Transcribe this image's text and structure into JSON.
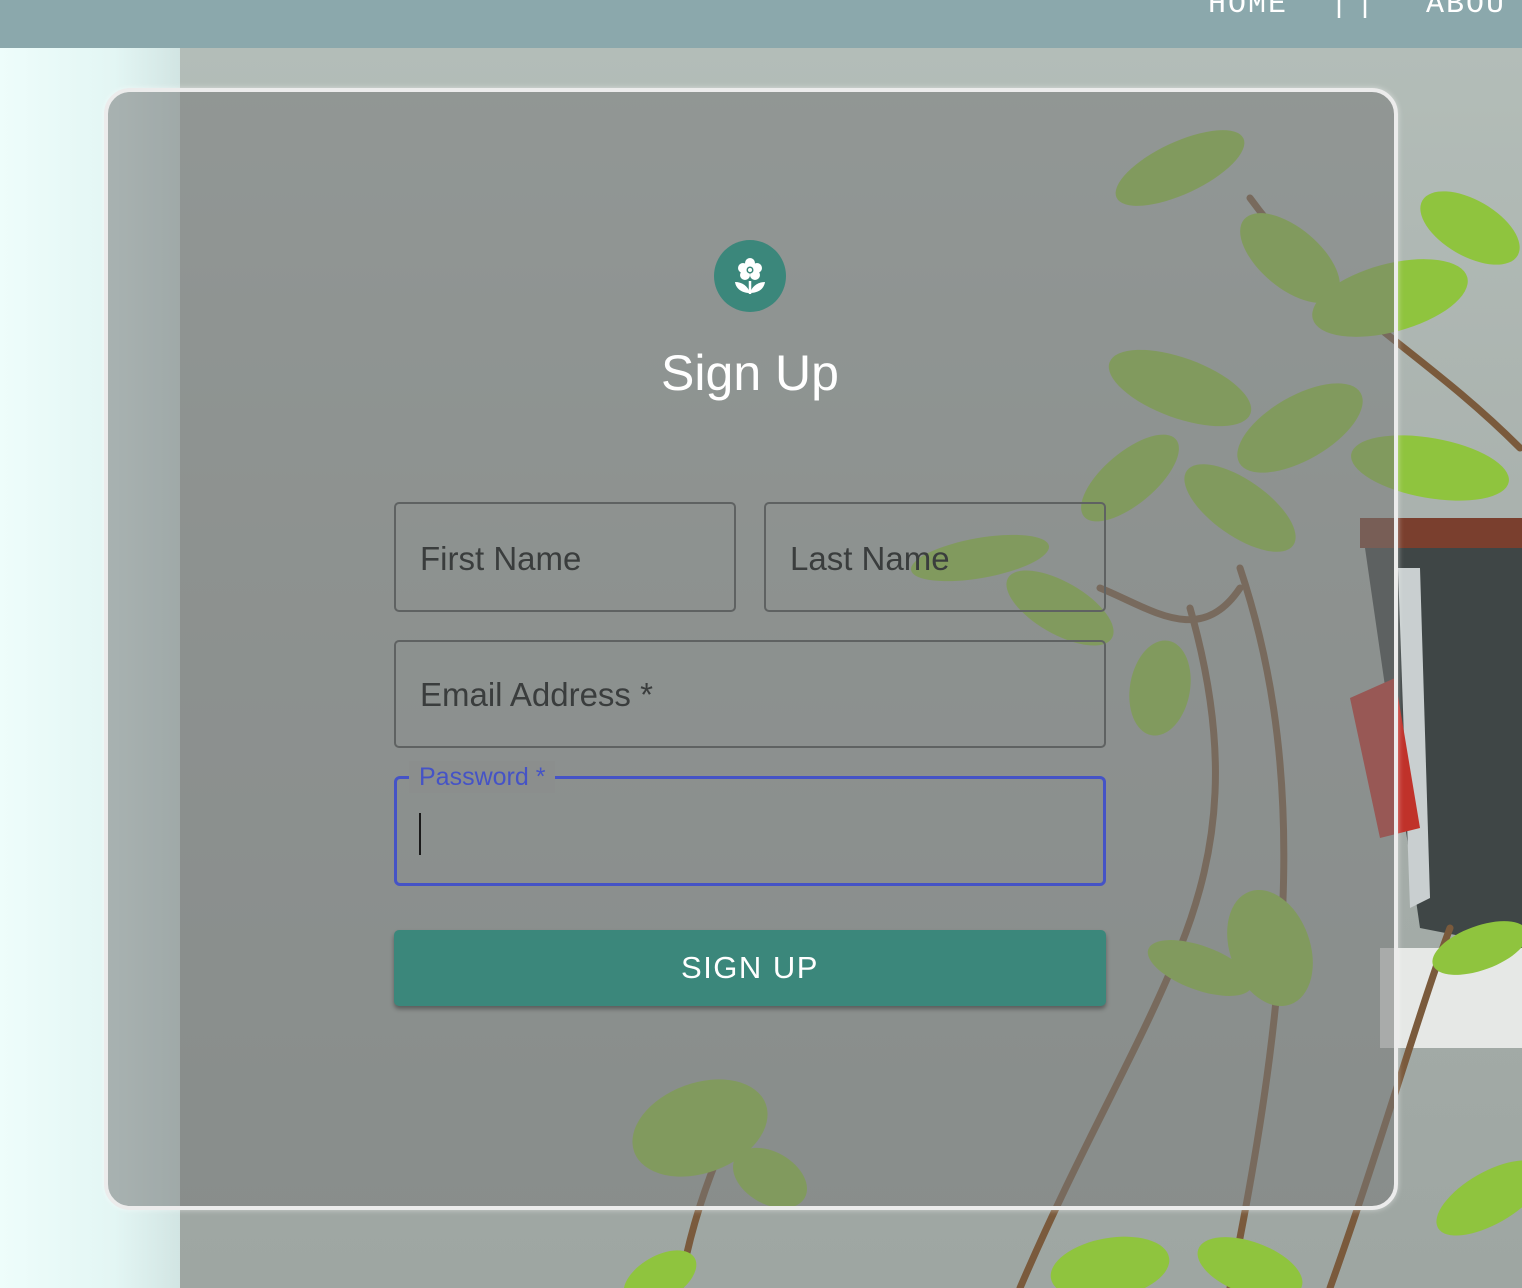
{
  "navbar": {
    "items": [
      {
        "label": "HOME"
      },
      {
        "label": "||"
      },
      {
        "label": "ABOU"
      }
    ]
  },
  "form": {
    "icon": "flower-icon",
    "title": "Sign Up",
    "fields": {
      "first_name": {
        "label": "First Name",
        "value": ""
      },
      "last_name": {
        "label": "Last Name",
        "value": ""
      },
      "email": {
        "label": "Email Address *",
        "value": ""
      },
      "password": {
        "label": "Password *",
        "value": "",
        "focused": true
      }
    },
    "submit_label": "SIGN UP"
  },
  "colors": {
    "accent": "#3b877b",
    "focus": "#4553c6",
    "navbar": "#8ba8ac"
  }
}
